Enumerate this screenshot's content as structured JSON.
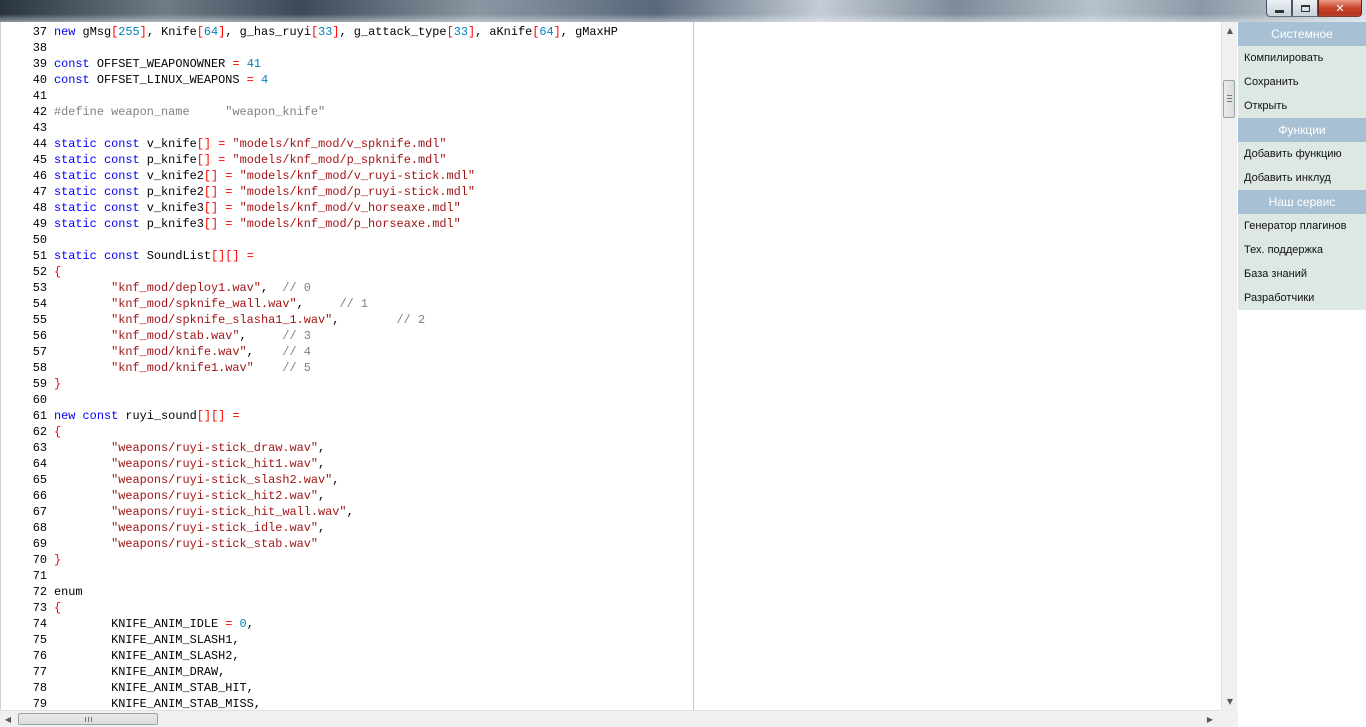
{
  "window": {
    "close_glyph": "✕"
  },
  "colors": {
    "keyword": "#0000ff",
    "string": "#a31515",
    "comment": "#808080",
    "number": "#0080c0",
    "operator": "#ff0000",
    "panel_header": "#a8c0d3",
    "panel_item_bg": "#dde7e4"
  },
  "editor": {
    "lines": [
      {
        "n": "37",
        "t": [
          [
            "kw",
            "new"
          ],
          [
            "fn",
            " gMsg"
          ],
          [
            "br",
            "["
          ],
          [
            "num",
            "255"
          ],
          [
            "br",
            "]"
          ],
          [
            "fn",
            ", Knife"
          ],
          [
            "br",
            "["
          ],
          [
            "num",
            "64"
          ],
          [
            "br",
            "]"
          ],
          [
            "fn",
            ", g_has_ruyi"
          ],
          [
            "br",
            "["
          ],
          [
            "num",
            "33"
          ],
          [
            "br",
            "]"
          ],
          [
            "fn",
            ", g_attack_type"
          ],
          [
            "br",
            "["
          ],
          [
            "num",
            "33"
          ],
          [
            "br",
            "]"
          ],
          [
            "fn",
            ", aKnife"
          ],
          [
            "br",
            "["
          ],
          [
            "num",
            "64"
          ],
          [
            "br",
            "]"
          ],
          [
            "fn",
            ", gMaxHP"
          ]
        ]
      },
      {
        "n": "38",
        "t": []
      },
      {
        "n": "39",
        "t": [
          [
            "kw",
            "const"
          ],
          [
            "fn",
            " OFFSET_WEAPONOWNER "
          ],
          [
            "op",
            "="
          ],
          [
            "fn",
            " "
          ],
          [
            "num",
            "41"
          ]
        ]
      },
      {
        "n": "40",
        "t": [
          [
            "kw",
            "const"
          ],
          [
            "fn",
            " OFFSET_LINUX_WEAPONS "
          ],
          [
            "op",
            "="
          ],
          [
            "fn",
            " "
          ],
          [
            "num",
            "4"
          ]
        ]
      },
      {
        "n": "41",
        "t": []
      },
      {
        "n": "42",
        "t": [
          [
            "pre",
            "#define weapon_name     \"weapon_knife\""
          ]
        ]
      },
      {
        "n": "43",
        "t": []
      },
      {
        "n": "44",
        "t": [
          [
            "kw",
            "static const"
          ],
          [
            "fn",
            " v_knife"
          ],
          [
            "br",
            "[]"
          ],
          [
            "fn",
            " "
          ],
          [
            "op",
            "="
          ],
          [
            "fn",
            " "
          ],
          [
            "str",
            "\"models/knf_mod/v_spknife.mdl\""
          ]
        ]
      },
      {
        "n": "45",
        "t": [
          [
            "kw",
            "static const"
          ],
          [
            "fn",
            " p_knife"
          ],
          [
            "br",
            "[]"
          ],
          [
            "fn",
            " "
          ],
          [
            "op",
            "="
          ],
          [
            "fn",
            " "
          ],
          [
            "str",
            "\"models/knf_mod/p_spknife.mdl\""
          ]
        ]
      },
      {
        "n": "46",
        "t": [
          [
            "kw",
            "static const"
          ],
          [
            "fn",
            " v_knife2"
          ],
          [
            "br",
            "[]"
          ],
          [
            "fn",
            " "
          ],
          [
            "op",
            "="
          ],
          [
            "fn",
            " "
          ],
          [
            "str",
            "\"models/knf_mod/v_ruyi-stick.mdl\""
          ]
        ]
      },
      {
        "n": "47",
        "t": [
          [
            "kw",
            "static const"
          ],
          [
            "fn",
            " p_knife2"
          ],
          [
            "br",
            "[]"
          ],
          [
            "fn",
            " "
          ],
          [
            "op",
            "="
          ],
          [
            "fn",
            " "
          ],
          [
            "str",
            "\"models/knf_mod/p_ruyi-stick.mdl\""
          ]
        ]
      },
      {
        "n": "48",
        "t": [
          [
            "kw",
            "static const"
          ],
          [
            "fn",
            " v_knife3"
          ],
          [
            "br",
            "[]"
          ],
          [
            "fn",
            " "
          ],
          [
            "op",
            "="
          ],
          [
            "fn",
            " "
          ],
          [
            "str",
            "\"models/knf_mod/v_horseaxe.mdl\""
          ]
        ]
      },
      {
        "n": "49",
        "t": [
          [
            "kw",
            "static const"
          ],
          [
            "fn",
            " p_knife3"
          ],
          [
            "br",
            "[]"
          ],
          [
            "fn",
            " "
          ],
          [
            "op",
            "="
          ],
          [
            "fn",
            " "
          ],
          [
            "str",
            "\"models/knf_mod/p_horseaxe.mdl\""
          ]
        ]
      },
      {
        "n": "50",
        "t": []
      },
      {
        "n": "51",
        "t": [
          [
            "kw",
            "static const"
          ],
          [
            "fn",
            " SoundList"
          ],
          [
            "br",
            "[][]"
          ],
          [
            "fn",
            " "
          ],
          [
            "op",
            "="
          ]
        ]
      },
      {
        "n": "52",
        "t": [
          [
            "br",
            "{"
          ]
        ]
      },
      {
        "n": "53",
        "t": [
          [
            "fn",
            "        "
          ],
          [
            "str",
            "\"knf_mod/deploy1.wav\""
          ],
          [
            "fn",
            ",  "
          ],
          [
            "cmt",
            "// 0"
          ]
        ]
      },
      {
        "n": "54",
        "t": [
          [
            "fn",
            "        "
          ],
          [
            "str",
            "\"knf_mod/spknife_wall.wav\""
          ],
          [
            "fn",
            ",     "
          ],
          [
            "cmt",
            "// 1"
          ]
        ]
      },
      {
        "n": "55",
        "t": [
          [
            "fn",
            "        "
          ],
          [
            "str",
            "\"knf_mod/spknife_slasha1_1.wav\""
          ],
          [
            "fn",
            ",        "
          ],
          [
            "cmt",
            "// 2"
          ]
        ]
      },
      {
        "n": "56",
        "t": [
          [
            "fn",
            "        "
          ],
          [
            "str",
            "\"knf_mod/stab.wav\""
          ],
          [
            "fn",
            ",     "
          ],
          [
            "cmt",
            "// 3"
          ]
        ]
      },
      {
        "n": "57",
        "t": [
          [
            "fn",
            "        "
          ],
          [
            "str",
            "\"knf_mod/knife.wav\""
          ],
          [
            "fn",
            ",    "
          ],
          [
            "cmt",
            "// 4"
          ]
        ]
      },
      {
        "n": "58",
        "t": [
          [
            "fn",
            "        "
          ],
          [
            "str",
            "\"knf_mod/knife1.wav\""
          ],
          [
            "fn",
            "    "
          ],
          [
            "cmt",
            "// 5"
          ]
        ]
      },
      {
        "n": "59",
        "t": [
          [
            "br",
            "}"
          ]
        ]
      },
      {
        "n": "60",
        "t": []
      },
      {
        "n": "61",
        "t": [
          [
            "kw",
            "new const"
          ],
          [
            "fn",
            " ruyi_sound"
          ],
          [
            "br",
            "[][]"
          ],
          [
            "fn",
            " "
          ],
          [
            "op",
            "="
          ]
        ]
      },
      {
        "n": "62",
        "t": [
          [
            "br",
            "{"
          ]
        ]
      },
      {
        "n": "63",
        "t": [
          [
            "fn",
            "        "
          ],
          [
            "str",
            "\"weapons/ruyi-stick_draw.wav\""
          ],
          [
            "fn",
            ","
          ]
        ]
      },
      {
        "n": "64",
        "t": [
          [
            "fn",
            "        "
          ],
          [
            "str",
            "\"weapons/ruyi-stick_hit1.wav\""
          ],
          [
            "fn",
            ","
          ]
        ]
      },
      {
        "n": "65",
        "t": [
          [
            "fn",
            "        "
          ],
          [
            "str",
            "\"weapons/ruyi-stick_slash2.wav\""
          ],
          [
            "fn",
            ","
          ]
        ]
      },
      {
        "n": "66",
        "t": [
          [
            "fn",
            "        "
          ],
          [
            "str",
            "\"weapons/ruyi-stick_hit2.wav\""
          ],
          [
            "fn",
            ","
          ]
        ]
      },
      {
        "n": "67",
        "t": [
          [
            "fn",
            "        "
          ],
          [
            "str",
            "\"weapons/ruyi-stick_hit_wall.wav\""
          ],
          [
            "fn",
            ","
          ]
        ]
      },
      {
        "n": "68",
        "t": [
          [
            "fn",
            "        "
          ],
          [
            "str",
            "\"weapons/ruyi-stick_idle.wav\""
          ],
          [
            "fn",
            ","
          ]
        ]
      },
      {
        "n": "69",
        "t": [
          [
            "fn",
            "        "
          ],
          [
            "str",
            "\"weapons/ruyi-stick_stab.wav\""
          ]
        ]
      },
      {
        "n": "70",
        "t": [
          [
            "br",
            "}"
          ]
        ]
      },
      {
        "n": "71",
        "t": []
      },
      {
        "n": "72",
        "t": [
          [
            "fn",
            "enum"
          ]
        ]
      },
      {
        "n": "73",
        "t": [
          [
            "br",
            "{"
          ]
        ]
      },
      {
        "n": "74",
        "t": [
          [
            "fn",
            "        KNIFE_ANIM_IDLE "
          ],
          [
            "op",
            "="
          ],
          [
            "fn",
            " "
          ],
          [
            "num",
            "0"
          ],
          [
            "fn",
            ","
          ]
        ]
      },
      {
        "n": "75",
        "t": [
          [
            "fn",
            "        KNIFE_ANIM_SLASH1,"
          ]
        ]
      },
      {
        "n": "76",
        "t": [
          [
            "fn",
            "        KNIFE_ANIM_SLASH2,"
          ]
        ]
      },
      {
        "n": "77",
        "t": [
          [
            "fn",
            "        KNIFE_ANIM_DRAW,"
          ]
        ]
      },
      {
        "n": "78",
        "t": [
          [
            "fn",
            "        KNIFE_ANIM_STAB_HIT,"
          ]
        ]
      },
      {
        "n": "79",
        "t": [
          [
            "fn",
            "        KNIFE_ANIM_STAB_MISS,"
          ]
        ]
      }
    ]
  },
  "scrollbars": {
    "up_glyph": "▲",
    "down_glyph": "▼",
    "left_glyph": "◀",
    "right_glyph": "▶"
  },
  "panel": {
    "sections": [
      {
        "title": "Системное",
        "items": [
          "Компилировать",
          "Сохранить",
          "Открыть"
        ]
      },
      {
        "title": "Функции",
        "items": [
          "Добавить функцию",
          "Добавить инклуд"
        ]
      },
      {
        "title": "Наш сервис",
        "items": [
          "Генератор плагинов",
          "Тех. поддержка",
          "База знаний",
          "Разработчики"
        ]
      }
    ]
  }
}
